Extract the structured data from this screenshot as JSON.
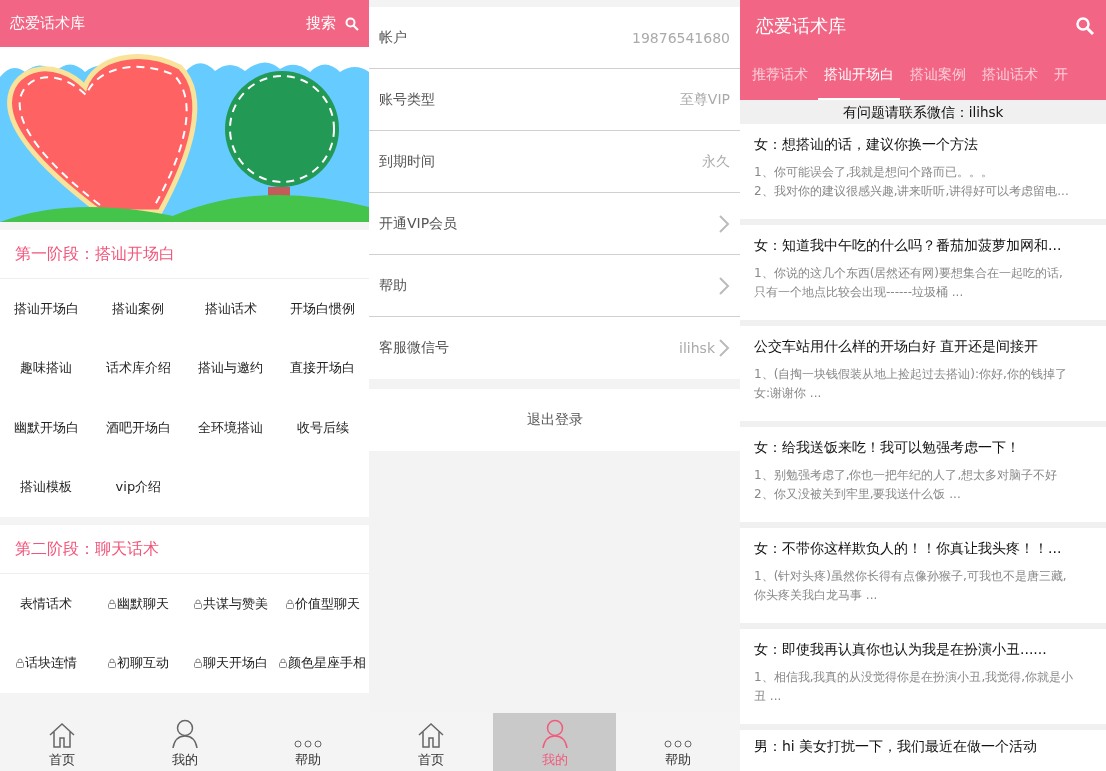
{
  "home_screen": {
    "header": {
      "title": "恋爱话术库",
      "search_label": "搜索"
    },
    "sections": [
      {
        "title": "第一阶段：搭讪开场白",
        "items": [
          {
            "label": "搭讪开场白",
            "locked": false
          },
          {
            "label": "搭讪案例",
            "locked": false
          },
          {
            "label": "搭讪话术",
            "locked": false
          },
          {
            "label": "开场白惯例",
            "locked": false
          },
          {
            "label": "趣味搭讪",
            "locked": false
          },
          {
            "label": "话术库介绍",
            "locked": false
          },
          {
            "label": "搭讪与邀约",
            "locked": false
          },
          {
            "label": "直接开场白",
            "locked": false
          },
          {
            "label": "幽默开场白",
            "locked": false
          },
          {
            "label": "酒吧开场白",
            "locked": false
          },
          {
            "label": "全环境搭讪",
            "locked": false
          },
          {
            "label": "收号后续",
            "locked": false
          },
          {
            "label": "搭讪模板",
            "locked": false
          },
          {
            "label": "vip介绍",
            "locked": false
          }
        ]
      },
      {
        "title": "第二阶段：聊天话术",
        "items": [
          {
            "label": "表情话术",
            "locked": false
          },
          {
            "label": "幽默聊天",
            "locked": true
          },
          {
            "label": "共谋与赞美",
            "locked": true
          },
          {
            "label": "价值型聊天",
            "locked": true
          },
          {
            "label": "话块连情",
            "locked": true
          },
          {
            "label": "初聊互动",
            "locked": true
          },
          {
            "label": "聊天开场白",
            "locked": true
          },
          {
            "label": "颜色星座手相",
            "locked": true
          }
        ]
      }
    ],
    "tab_bar": [
      {
        "label": "首页",
        "kind": "home",
        "selected": false
      },
      {
        "label": "我的",
        "kind": "profile",
        "selected": false
      },
      {
        "label": "帮助",
        "kind": "more",
        "selected": false
      }
    ]
  },
  "profile_screen": {
    "rows": [
      {
        "label": "帐户",
        "value": "19876541680",
        "arrow": false
      },
      {
        "label": "账号类型",
        "value": "至尊VIP",
        "arrow": false
      },
      {
        "label": "到期时间",
        "value": "永久",
        "arrow": false
      },
      {
        "label": "开通VIP会员",
        "arrow": true
      },
      {
        "label": "帮助",
        "arrow": true
      },
      {
        "label": "客服微信号",
        "value": "ilihsk",
        "arrow": true
      }
    ],
    "logout_button": "退出登录",
    "tab_bar": [
      {
        "label": "首页",
        "kind": "home",
        "selected": false
      },
      {
        "label": "我的",
        "kind": "profile",
        "selected": true
      },
      {
        "label": "帮助",
        "kind": "more",
        "selected": false
      }
    ]
  },
  "list_screen": {
    "header": {
      "title": "恋爱话术库"
    },
    "tabs": [
      {
        "label": "推荐话术",
        "selected": false
      },
      {
        "label": "搭讪开场白",
        "selected": true
      },
      {
        "label": "搭讪案例",
        "selected": false
      },
      {
        "label": "搭讪话术",
        "selected": false
      },
      {
        "label": "开",
        "selected": false
      }
    ],
    "notice": "有问题请联系微信：ilihsk",
    "cards": [
      {
        "title": "女：想搭讪的话，建议你换一个方法",
        "lines": [
          "1、你可能误会了,我就是想问个路而已。。。",
          "2、我对你的建议很感兴趣,讲来听听,讲得好可以考虑留电..."
        ]
      },
      {
        "title": "女：知道我中午吃的什么吗？番茄加菠萝加网和...",
        "lines": [
          "1、你说的这几个东西(居然还有网)要想集合在一起吃的话,",
          "只有一个地点比较会出现------垃圾桶 ..."
        ]
      },
      {
        "title": "公交车站用什么样的开场白好 直开还是间接开",
        "lines": [
          "1、(自掏一块钱假装从地上捡起过去搭讪):你好,你的钱掉了",
          "女:谢谢你 ..."
        ]
      },
      {
        "title": "女：给我送饭来吃！我可以勉强考虑一下！",
        "lines": [
          "1、别勉强考虑了,你也一把年纪的人了,想太多对脑子不好",
          "2、你又没被关到牢里,要我送什么饭 ..."
        ]
      },
      {
        "title": "女：不带你这样欺负人的！！你真让我头疼！！...",
        "lines": [
          "1、(针对头疼)虽然你长得有点像孙猴子,可我也不是唐三藏,",
          "你头疼关我白龙马事 ..."
        ]
      },
      {
        "title": "女：即使我再认真你也认为我是在扮演小丑......",
        "lines": [
          "1、相信我,我真的从没觉得你是在扮演小丑,我觉得,你就是小",
          "丑 ..."
        ]
      },
      {
        "title": "男：hi 美女打扰一下，我们最近在做一个活动"
      }
    ]
  }
}
